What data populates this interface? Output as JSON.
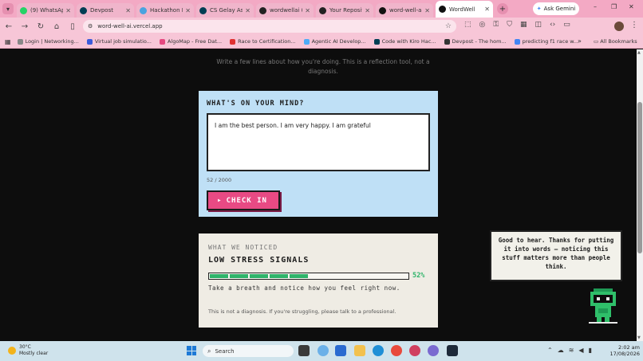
{
  "browser": {
    "tabs": [
      {
        "title": "(9) WhatsApp",
        "color": "#25d366",
        "active": false
      },
      {
        "title": "Devpost",
        "color": "#003e54",
        "active": false
      },
      {
        "title": "Hackathon Id",
        "color": "#4aa3df",
        "active": false
      },
      {
        "title": "CS Gelay Ass",
        "color": "#003e54",
        "active": false
      },
      {
        "title": "wordwellai (",
        "color": "#222222",
        "active": false
      },
      {
        "title": "Your Reposito",
        "color": "#222222",
        "active": false
      },
      {
        "title": "word-well-ai",
        "color": "#111111",
        "active": false
      },
      {
        "title": "WordWell",
        "color": "#111111",
        "active": true
      }
    ],
    "new_tab": "+",
    "gemini_label": "Ask Gemini",
    "window_controls": [
      "–",
      "❐",
      "✕"
    ],
    "url": "word-well-ai.vercel.app",
    "bookmarks": [
      {
        "label": "Login | Networking...",
        "color": "#888888"
      },
      {
        "label": "Virtual job simulatio...",
        "color": "#3b5bdb"
      },
      {
        "label": "AlgoMap - Free Dat...",
        "color": "#e64980"
      },
      {
        "label": "Race to Certification...",
        "color": "#e03131"
      },
      {
        "label": "Agentic AI Develop...",
        "color": "#4dabf7"
      },
      {
        "label": "Code with Kiro Hac...",
        "color": "#003e54"
      },
      {
        "label": "Devpost - The hom...",
        "color": "#333333"
      },
      {
        "label": "predicting f1 race w...",
        "color": "#4285f4"
      }
    ],
    "all_bookmarks": "All Bookmarks"
  },
  "page": {
    "intro": "Write a few lines about how you're doing. This is a reflection tool, not a diagnosis.",
    "input_card": {
      "heading": "WHAT'S ON YOUR MIND?",
      "text": "I am the best person. I am very happy. I am grateful",
      "counter": "52 / 2000",
      "button_label": "CHECK IN",
      "button_icon": "play-icon"
    },
    "result_card": {
      "label": "WHAT WE NOTICED",
      "signal": "LOW STRESS SIGNALS",
      "percent": 52,
      "percent_label": "52%",
      "advice": "Take a breath and notice how you feel right now.",
      "disclaimer": "This is not a diagnosis. If you're struggling, please talk to a professional."
    },
    "mascot": {
      "speech": "Good to hear. Thanks for putting it into words — noticing this stuff matters more than people think."
    }
  },
  "taskbar": {
    "weather_temp": "30°C",
    "weather_desc": "Mostly clear",
    "search_placeholder": "Search",
    "time": "2:02 am",
    "date": "17/08/2026"
  },
  "colors": {
    "accent_pink": "#e84a84",
    "meter_green": "#2fb46a",
    "input_card_bg": "#bfe0f6",
    "result_card_bg": "#efece4"
  }
}
